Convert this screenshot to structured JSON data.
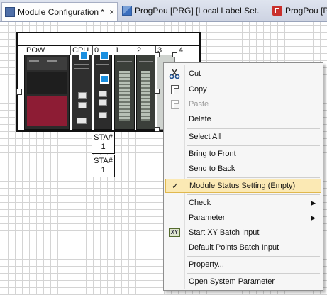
{
  "tabs": [
    {
      "label": "Module Configuration *",
      "close": "×",
      "icon": "module-config-icon",
      "active": true
    },
    {
      "label": "ProgPou [PRG] [Local Label Set...",
      "icon": "program-icon",
      "active": false
    },
    {
      "label": "ProgPou [PR",
      "icon": "program-red-icon",
      "active": false
    }
  ],
  "rack": {
    "slots": [
      "POW",
      "CPU",
      "0",
      "1",
      "2",
      "3",
      "4"
    ]
  },
  "station_boxes": [
    {
      "line1": "STA#",
      "line2": "1"
    },
    {
      "line1": "STA#",
      "line2": "1"
    }
  ],
  "context_menu": {
    "items": [
      {
        "label": "Cut",
        "icon": "scissors-icon",
        "enabled": true
      },
      {
        "label": "Copy",
        "icon": "copy-icon",
        "enabled": true
      },
      {
        "label": "Paste",
        "icon": "paste-icon",
        "enabled": false
      },
      {
        "label": "Delete",
        "enabled": true
      },
      {
        "label": "Select All",
        "enabled": true
      },
      {
        "label": "Bring to Front",
        "enabled": true
      },
      {
        "label": "Send to Back",
        "enabled": true
      },
      {
        "label": "Module Status Setting (Empty)",
        "checked": true,
        "enabled": true,
        "highlighted": true
      },
      {
        "label": "Check",
        "submenu": true,
        "enabled": true
      },
      {
        "label": "Parameter",
        "submenu": true,
        "enabled": true
      },
      {
        "label": "Start XY Batch Input",
        "icon": "xy-batch-icon",
        "enabled": true
      },
      {
        "label": "Default Points Batch Input",
        "enabled": true
      },
      {
        "label": "Property...",
        "enabled": true
      },
      {
        "label": "Open System Parameter",
        "enabled": true
      }
    ],
    "check_mark": "✓",
    "submenu_arrow": "▶"
  },
  "colors": {
    "highlight_bg": "#fbe9b4",
    "highlight_border": "#e0b84e",
    "status_blue": "#1a8fe0",
    "power_red": "#8d1c34"
  }
}
